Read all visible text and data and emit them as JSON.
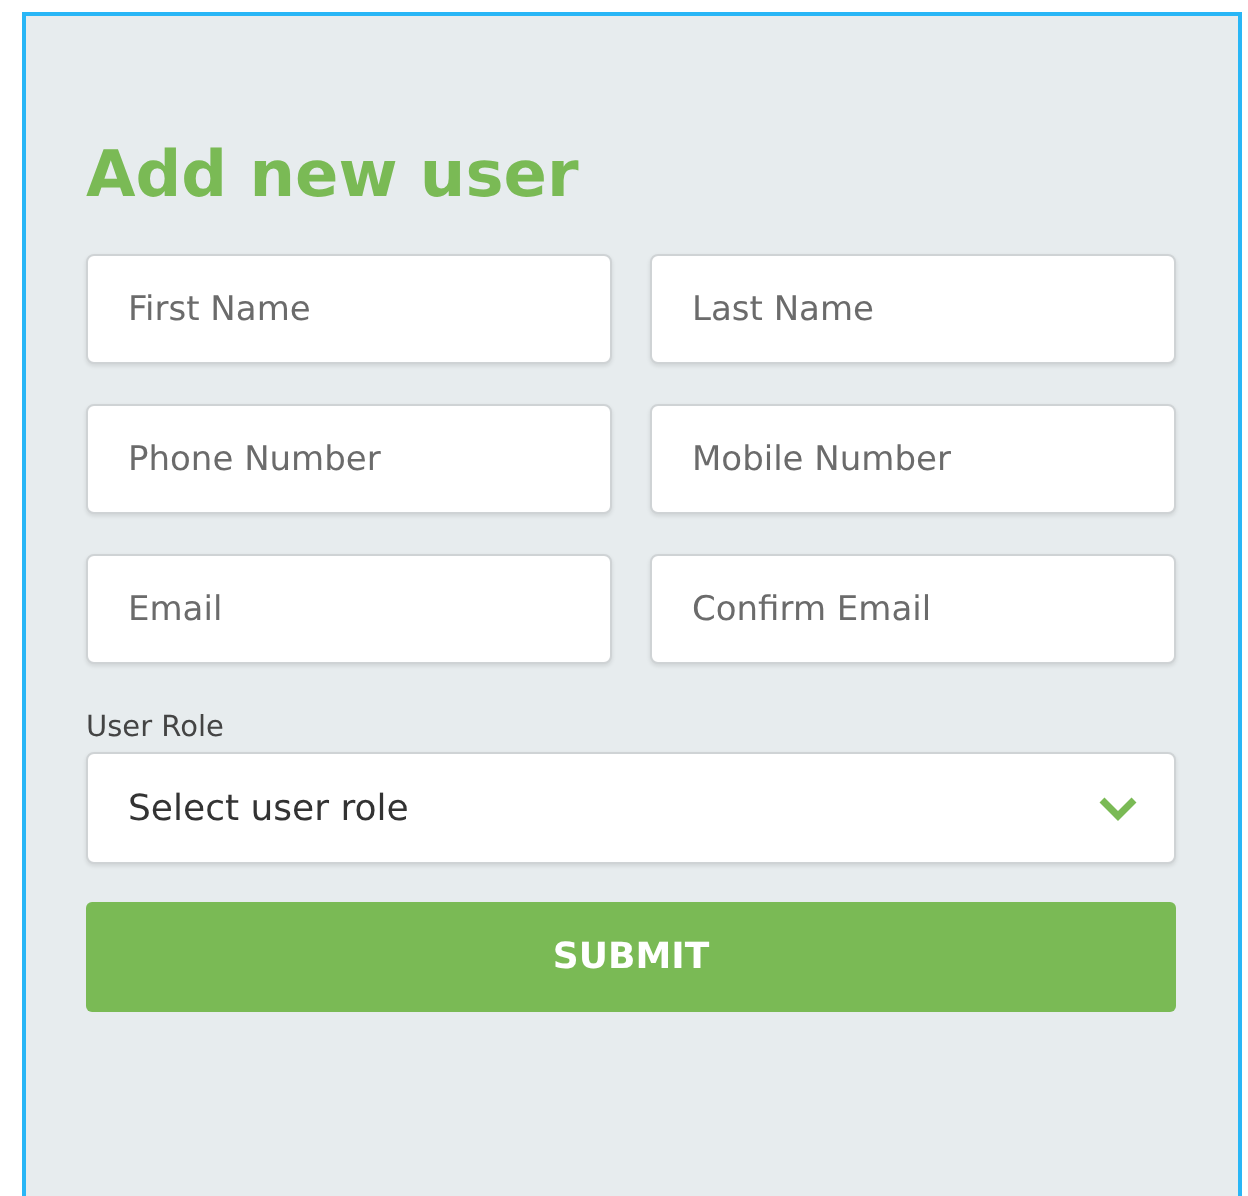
{
  "title": "Add new user",
  "fields": [
    {
      "placeholder": "First Name"
    },
    {
      "placeholder": "Last Name"
    },
    {
      "placeholder": "Phone Number"
    },
    {
      "placeholder": "Mobile Number"
    },
    {
      "placeholder": "Email"
    },
    {
      "placeholder": "Confirm Email"
    }
  ],
  "role": {
    "label": "User Role",
    "value": "Select user role"
  },
  "submit": "SUBMIT"
}
